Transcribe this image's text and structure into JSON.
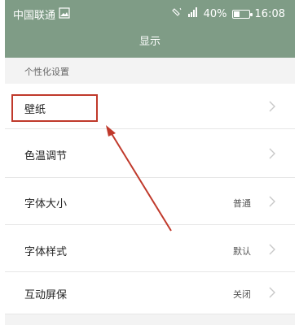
{
  "status": {
    "carrier": "中国联通",
    "battery_text": "40%",
    "battery_level": 0.4,
    "time": "16:08"
  },
  "header": {
    "title": "显示"
  },
  "section": {
    "label": "个性化设置"
  },
  "items": [
    {
      "label": "壁纸",
      "value": ""
    },
    {
      "label": "色温调节",
      "value": ""
    },
    {
      "label": "字体大小",
      "value": "普通"
    },
    {
      "label": "字体样式",
      "value": "默认"
    },
    {
      "label": "互动屏保",
      "value": "关闭"
    }
  ],
  "colors": {
    "header_bg": "#7f9c86",
    "highlight": "#c0392b"
  }
}
